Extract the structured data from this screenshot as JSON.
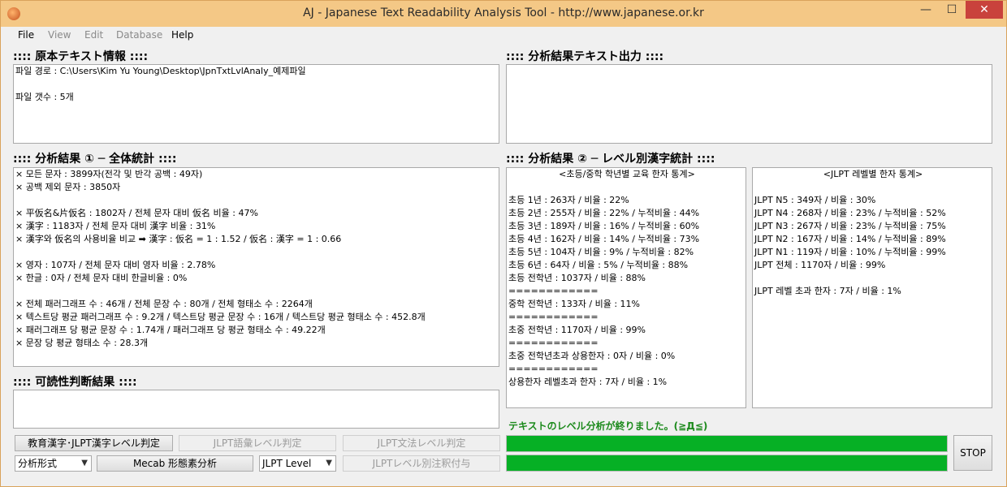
{
  "window": {
    "title": "AJ - Japanese Text Readability Analysis Tool - http://www.japanese.or.kr",
    "min_glyph": "—",
    "max_glyph": "☐",
    "close_glyph": "✕"
  },
  "menu": [
    "File",
    "View",
    "Edit",
    "Database",
    "Help"
  ],
  "sections": {
    "original_info_title": ":::: 原本テキスト情報 ::::",
    "output_title": ":::: 分析結果テキスト出力 ::::",
    "overall_title": ":::: 分析結果 ① ─ 全体統計 ::::",
    "level_title": ":::: 分析結果 ② ─ レベル別漢字統計 ::::",
    "readability_title": ":::: 可読性判断結果 ::::"
  },
  "original_info": {
    "path": "파일 경로 : C:\\Users\\Kim Yu Young\\Desktop\\JpnTxtLvlAnaly_예제파일",
    "count": "파일 갯수 : 5개"
  },
  "overall_stats": {
    "l1": "× 모든 문자 : 3899자(전각 및 반각 공백 : 49자)",
    "l2": "× 공백 제외 문자 : 3850자",
    "l3": "× 平仮名&片仮名 : 1802자   /   전체 문자 대비 仮名 비율 : 47%",
    "l4": "× 漢字 : 1183자   /   전체 문자 대비 漢字 비율 : 31%",
    "l5": "× 漢字와 仮名의 사용비율 비교 ➡ 漢字 : 仮名 = 1 : 1.52   /   仮名 : 漢字 = 1 : 0.66",
    "l6": "× 영자 : 107자   /   전체 문자 대비 영자 비율 : 2.78%",
    "l7": "× 한글 : 0자   /   전체 문자 대비 한글비율 : 0%",
    "l8": "×  전체 패러그래프 수 : 46개   /   전체 문장 수 : 80개   /   전체 형태소 수 : 2264개",
    "l9": "×  텍스트당 평균 패러그래프 수 : 9.2개   /   텍스트당 평균 문장 수 : 16개   /   텍스트당 평균 형태소 수 : 452.8개",
    "l10": "×  패러그래프 당 평균 문장 수 : 1.74개   /   패러그래프 당 평균 형태소 수 : 49.22개",
    "l11": "×  문장 당 평균 형태소 수 : 28.3개"
  },
  "school_stats": {
    "header": "<초등/중학 학년별 교육 한자 통계>",
    "g1": "초등 1년 : 263자 / 비율 : 22%",
    "g2": "초등 2년 : 255자 / 비율 : 22% / 누적비율 : 44%",
    "g3": "초등 3년 : 189자 / 비율 : 16% / 누적비율 : 60%",
    "g4": "초등 4년 : 162자 / 비율 : 14% / 누적비율 : 73%",
    "g5": "초등 5년 : 104자 / 비율 : 9% / 누적비율 : 82%",
    "g6": "초등 6년 : 64자 / 비율 : 5% / 누적비율 : 88%",
    "elem_all": "초등 전학년 : 1037자 / 비율 : 88%",
    "sep": "============",
    "middle_all": "중학 전학년 : 133자 / 비율 : 11%",
    "elem_middle_all": "초중 전학년 : 1170자 / 비율 : 99%",
    "beyond_common": "초중 전학년초과 상용한자 : 0자 / 비율 : 0%",
    "beyond_level": "상용한자 레벨초과 한자 : 7자 / 비율 : 1%"
  },
  "jlpt_stats": {
    "header": "<JLPT 레벨별 한자 통계>",
    "n5": "JLPT N5 : 349자 / 비율 : 30%",
    "n4": "JLPT N4 : 268자 / 비율 : 23% / 누적비율 : 52%",
    "n3": "JLPT N3 : 267자 / 비율 : 23% / 누적비율 : 75%",
    "n2": "JLPT N2 : 167자 / 비율 : 14% / 누적비율 : 89%",
    "n1": "JLPT N1 : 119자 / 비율 : 10% / 누적비율 : 99%",
    "all": "JLPT 전체 : 1170자 / 비율 : 99%",
    "beyond": "JLPT 레벨 초과 한자 : 7자 / 비율 : 1%"
  },
  "buttons": {
    "kanji_level": "教育漢字･JLPT漢字レベル判定",
    "vocab_level": "JLPT語彙レベル判定",
    "grammar_level": "JLPT文法レベル判定",
    "mecab": "Mecab 形態素分析",
    "annotate": "JLPTレベル別注釈付与",
    "stop": "STOP"
  },
  "selects": {
    "analysis_format": "分析形式",
    "jlpt_level": "JLPT Level"
  },
  "status": {
    "message": "テキストのレベル分析が終りました。(≧Д≦)",
    "progress1": 1.0,
    "progress2": 1.0
  }
}
